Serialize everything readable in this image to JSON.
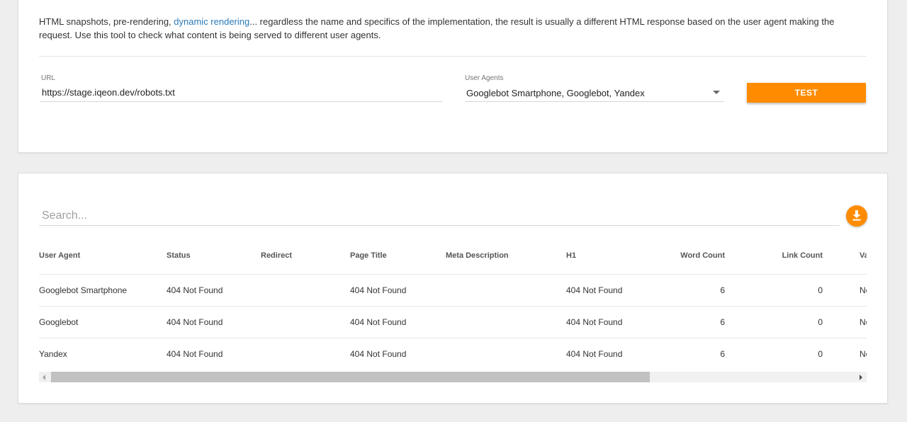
{
  "intro": {
    "text_before": "HTML snapshots, pre-rendering, ",
    "link_text": "dynamic rendering",
    "text_after": "... regardless the name and specifics of the implementation, the result is usually a different HTML response based on the user agent making the request. Use this tool to check what content is being served to different user agents."
  },
  "form": {
    "url_label": "URL",
    "url_value": "https://stage.iqeon.dev/robots.txt",
    "agents_label": "User Agents",
    "agents_value": "Googlebot Smartphone, Googlebot, Yandex",
    "test_label": "TEST"
  },
  "results": {
    "search_placeholder": "Search...",
    "download_icon": "download-icon",
    "columns": [
      "User Agent",
      "Status",
      "Redirect",
      "Page Title",
      "Meta Description",
      "H1",
      "Word Count",
      "Link Count",
      "Va"
    ],
    "rows": [
      [
        "Googlebot Smartphone",
        "404 Not Found",
        "",
        "404 Not Found",
        "",
        "404 Not Found",
        "6",
        "0",
        "No"
      ],
      [
        "Googlebot",
        "404 Not Found",
        "",
        "404 Not Found",
        "",
        "404 Not Found",
        "6",
        "0",
        "No"
      ],
      [
        "Yandex",
        "404 Not Found",
        "",
        "404 Not Found",
        "",
        "404 Not Found",
        "6",
        "0",
        "No"
      ]
    ]
  },
  "colors": {
    "accent": "#ff8c00",
    "link": "#2a7ab8",
    "background": "#eeeeee"
  }
}
